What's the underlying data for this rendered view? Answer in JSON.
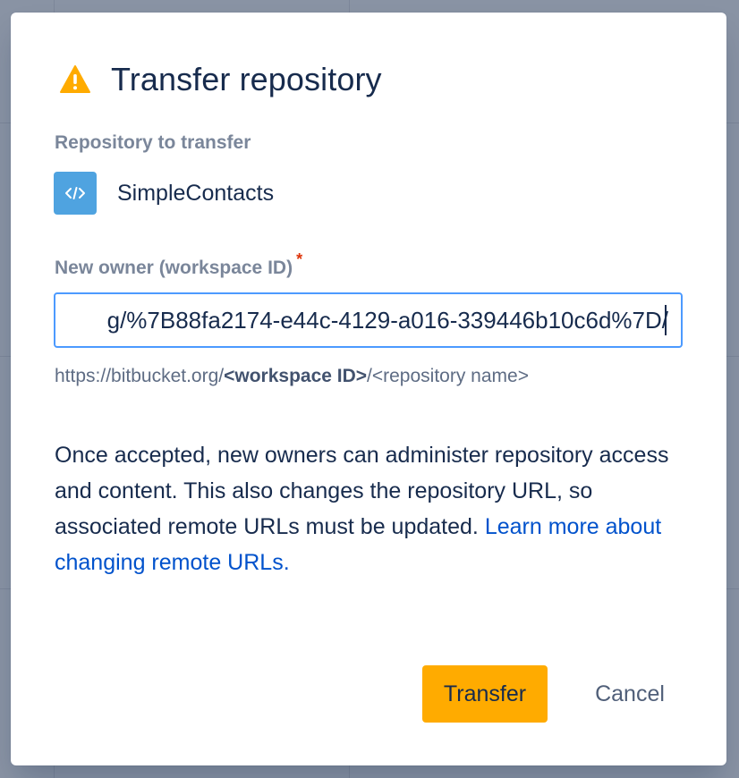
{
  "dialog": {
    "title": "Transfer repository",
    "repo_label": "Repository to transfer",
    "repo_name": "SimpleContacts",
    "owner_label": "New owner (workspace ID)",
    "required_mark": "*",
    "owner_value": "g/%7B88fa2174-e44c-4129-a016-339446b10c6d%7D/",
    "url_hint": {
      "prefix": "https://bitbucket.org/",
      "workspace": "<workspace ID>",
      "suffix": "/<repository name>"
    },
    "description": "Once accepted, new owners can administer repository access and content. This also changes the repository URL, so associated remote URLs must be updated.",
    "learn_more_link": "Learn more about changing remote URLs.",
    "transfer_button": "Transfer",
    "cancel_button": "Cancel"
  },
  "icons": {
    "warning": "warning-icon",
    "repository": "code-icon"
  },
  "colors": {
    "primary_button": "#ffab00",
    "link": "#0052cc",
    "input_focus_border": "#4c9aff",
    "warning": "#ffab00",
    "repo_icon_bg": "#4fa3e0"
  }
}
